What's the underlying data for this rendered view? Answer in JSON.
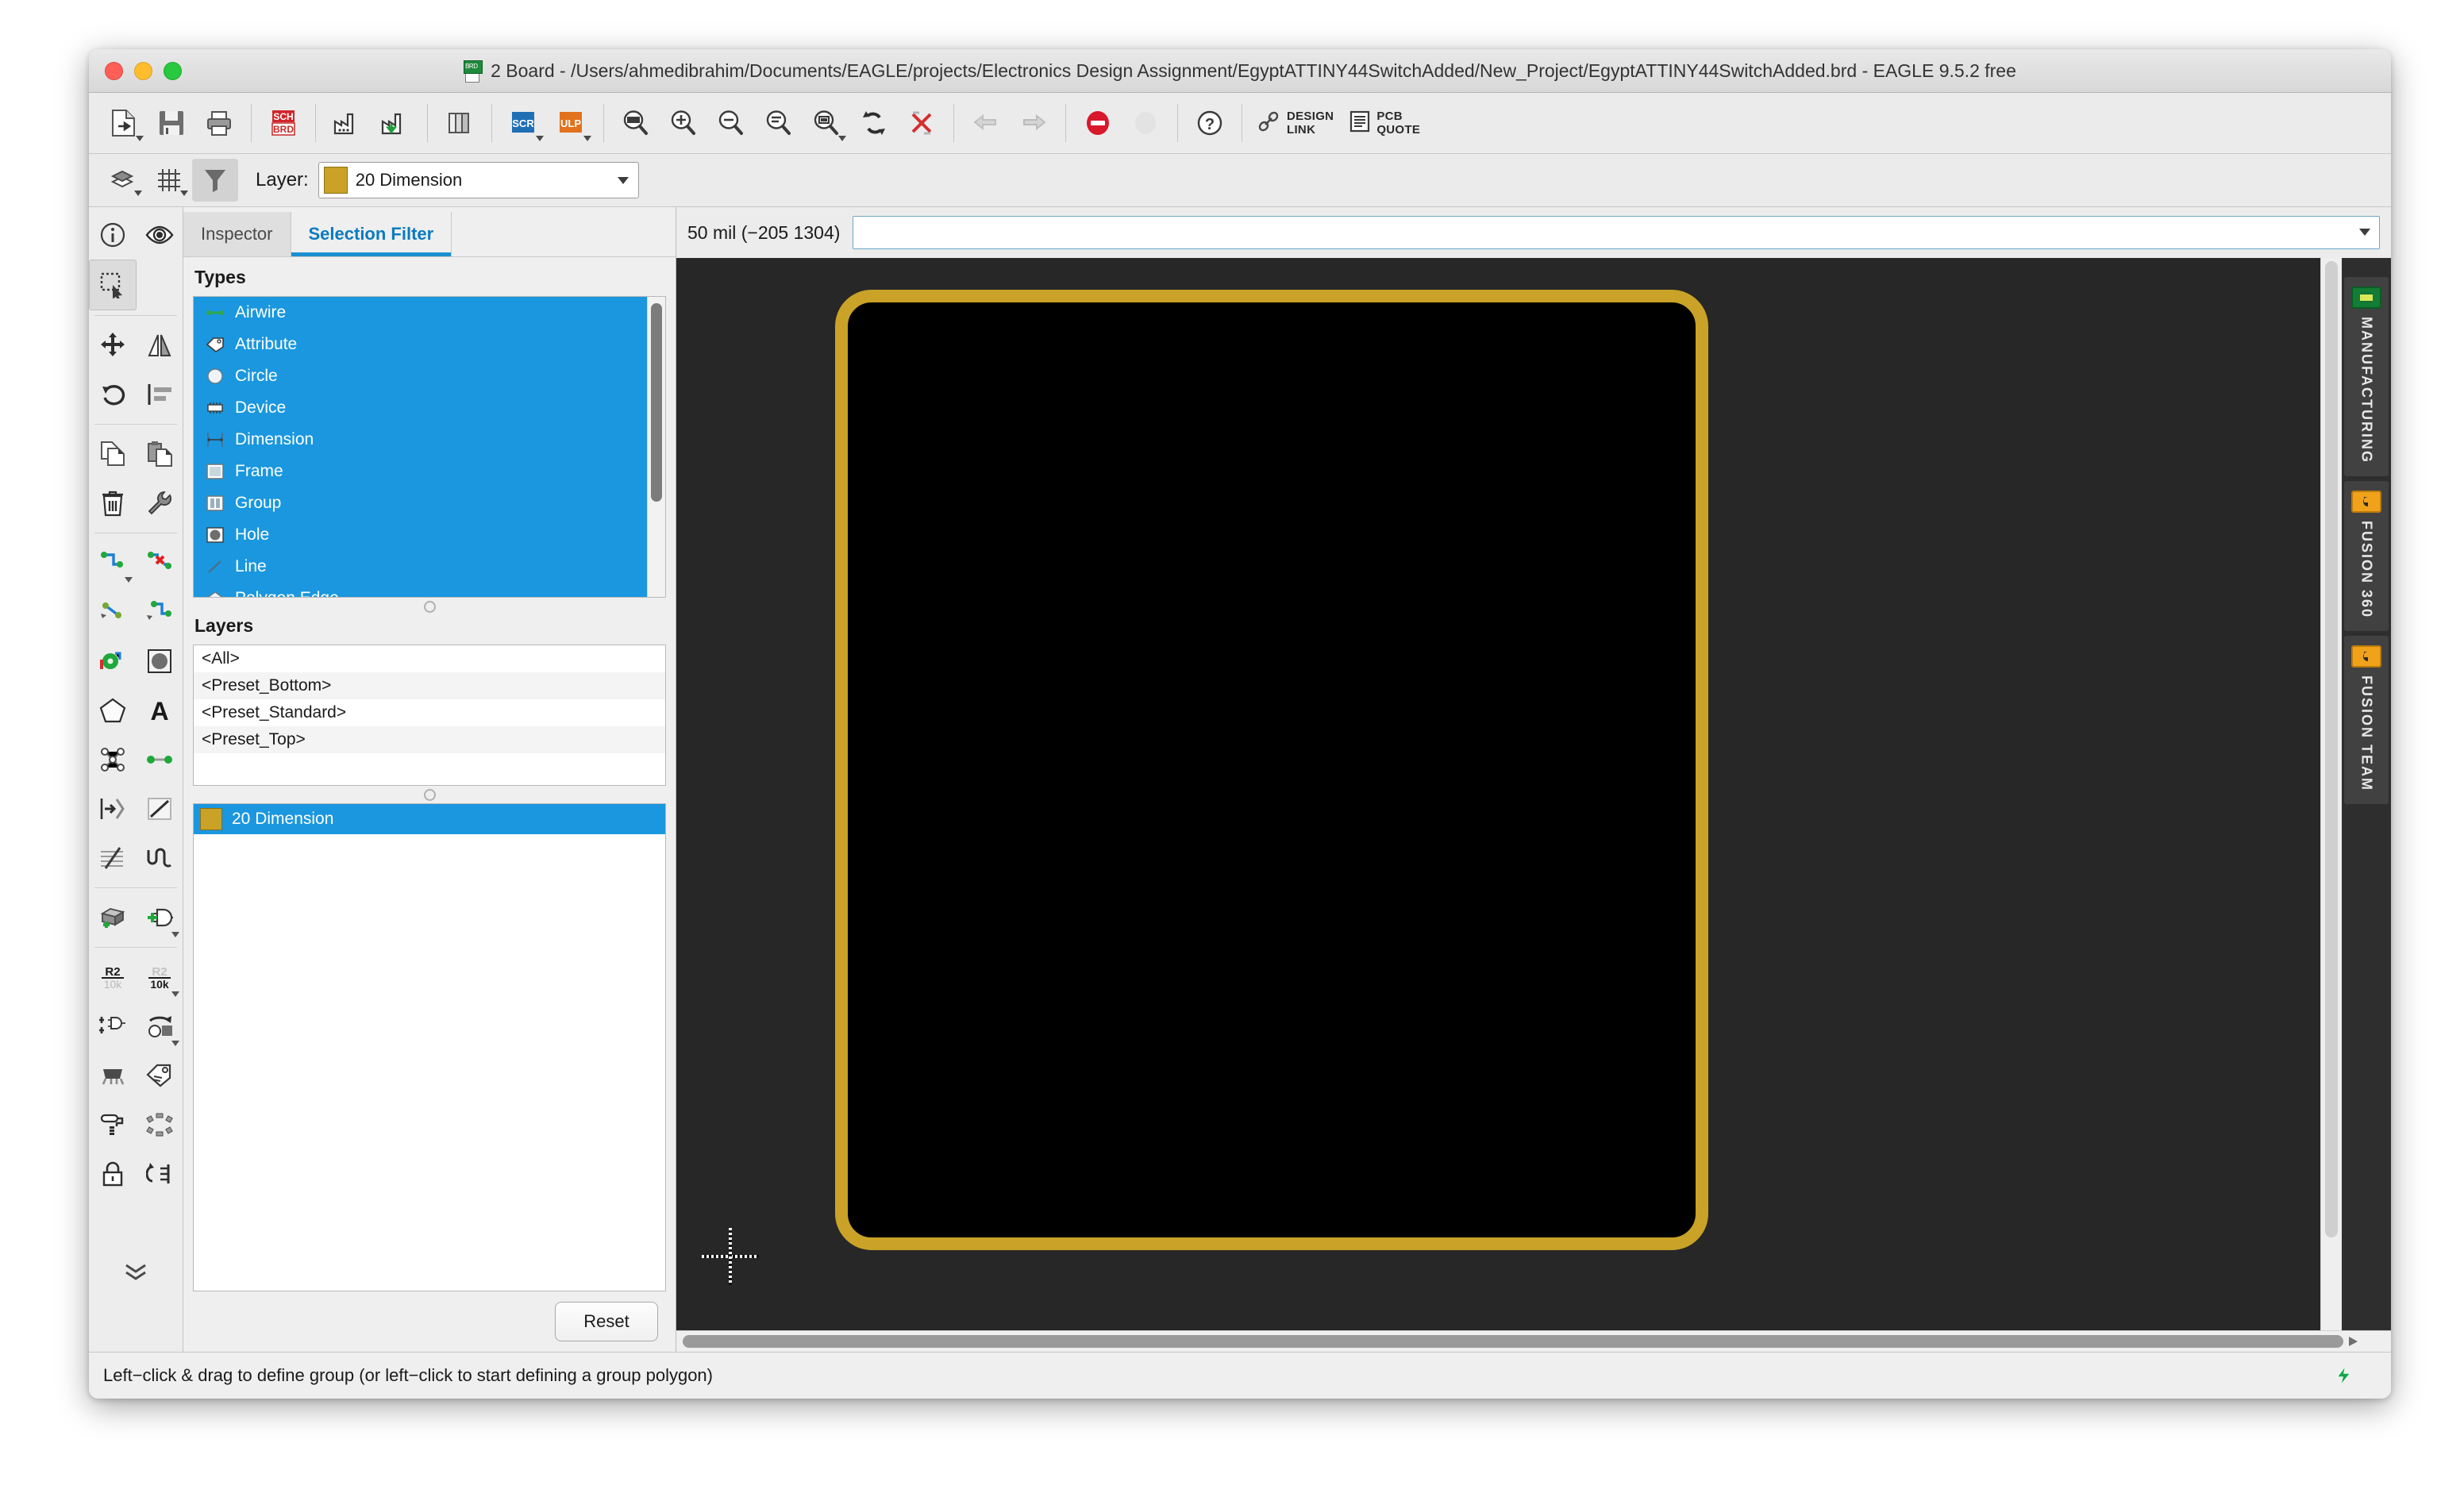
{
  "window": {
    "title": "2 Board - /Users/ahmedibrahim/Documents/EAGLE/projects/Electronics Design Assignment/EgyptATTINY44SwitchAdded/New_Project/EgyptATTINY44SwitchAdded.brd - EAGLE 9.5.2 free",
    "app_icon": "brd-file-icon",
    "controls": {
      "close": "close-button",
      "minimize": "minimize-button",
      "zoom": "zoom-button"
    }
  },
  "toolbar_main": {
    "items": [
      {
        "name": "new-file-button",
        "icon": "new-file-icon",
        "has_menu": true
      },
      {
        "name": "save-button",
        "icon": "floppy-disk-icon",
        "has_menu": false
      },
      {
        "name": "print-button",
        "icon": "printer-icon",
        "has_menu": false
      },
      {
        "name": "switch-to-schematic-button",
        "icon": "sch-brd-icon",
        "has_menu": false
      },
      {
        "name": "cam-processor-button",
        "icon": "factory-icon",
        "has_menu": false
      },
      {
        "name": "manufacturing-export-button",
        "icon": "factory-download-icon",
        "has_menu": false
      },
      {
        "name": "library-manager-button",
        "icon": "library-books-icon",
        "has_menu": false
      },
      {
        "name": "script-button",
        "icon": "scr-icon",
        "has_menu": true
      },
      {
        "name": "ulp-button",
        "icon": "ulp-icon",
        "has_menu": true
      },
      {
        "name": "zoom-fit-button",
        "icon": "zoom-fit-icon",
        "has_menu": false
      },
      {
        "name": "zoom-in-button",
        "icon": "zoom-in-icon",
        "has_menu": false
      },
      {
        "name": "zoom-out-button",
        "icon": "zoom-out-icon",
        "has_menu": false
      },
      {
        "name": "zoom-select-button",
        "icon": "zoom-select-icon",
        "has_menu": false
      },
      {
        "name": "zoom-region-button",
        "icon": "zoom-region-icon",
        "has_menu": true
      },
      {
        "name": "redraw-button",
        "icon": "refresh-icon",
        "has_menu": false
      },
      {
        "name": "ratsnest-button",
        "icon": "ratsnest-icon",
        "has_menu": false
      },
      {
        "name": "undo-button",
        "icon": "undo-arrow-icon",
        "has_menu": false
      },
      {
        "name": "redo-button",
        "icon": "redo-arrow-icon",
        "has_menu": false
      },
      {
        "name": "stop-button",
        "icon": "stop-sign-icon",
        "has_menu": false
      },
      {
        "name": "drc-button",
        "icon": "drc-icon",
        "has_menu": false
      },
      {
        "name": "help-button",
        "icon": "question-mark-icon",
        "has_menu": false
      }
    ],
    "design_link": {
      "line1": "DESIGN",
      "line2": "LINK",
      "icon": "chain-link-icon"
    },
    "pcb_quote": {
      "line1": "PCB",
      "line2": "QUOTE",
      "icon": "document-lines-icon"
    }
  },
  "toolbar_layers": {
    "display_layers_button": "layers-stack-icon",
    "grid_button": "grid-icon",
    "selection_filter_button": "funnel-icon",
    "layer_label": "Layer:",
    "layer_value": "20 Dimension",
    "layer_color": "#c9a227"
  },
  "tool_palette": {
    "groups": [
      {
        "tools": [
          {
            "name": "info-tool",
            "icon": "info-circle-icon",
            "selected": false
          },
          {
            "name": "show-tool",
            "icon": "eye-icon",
            "selected": false
          }
        ]
      },
      {
        "tools": [
          {
            "name": "group-tool",
            "icon": "marquee-select-icon",
            "selected": true
          }
        ]
      },
      {
        "tools": [
          {
            "name": "move-tool",
            "icon": "four-arrows-move-icon",
            "selected": false
          },
          {
            "name": "mirror-tool",
            "icon": "mirror-triangles-icon",
            "selected": false
          },
          {
            "name": "rotate-tool",
            "icon": "rotate-arrow-icon",
            "selected": false
          },
          {
            "name": "align-tool",
            "icon": "align-left-icon",
            "selected": false
          }
        ]
      },
      {
        "tools": [
          {
            "name": "copy-tool",
            "icon": "copy-pages-icon",
            "selected": false
          },
          {
            "name": "paste-tool",
            "icon": "clipboard-paste-icon",
            "selected": false
          },
          {
            "name": "delete-tool",
            "icon": "trash-can-icon",
            "selected": false
          },
          {
            "name": "change-tool",
            "icon": "wrench-icon",
            "selected": false
          }
        ]
      },
      {
        "tools": [
          {
            "name": "route-tool",
            "icon": "route-track-icon",
            "selected": false,
            "has_menu": true
          },
          {
            "name": "ripup-tool",
            "icon": "ripup-track-icon",
            "selected": false
          },
          {
            "name": "split-tool",
            "icon": "split-track-icon",
            "selected": false
          },
          {
            "name": "miter-tool",
            "icon": "miter-track-icon",
            "selected": false
          },
          {
            "name": "via-tool",
            "icon": "via-pad-icon",
            "selected": false
          },
          {
            "name": "hole-tool",
            "icon": "hole-pad-icon",
            "selected": false
          },
          {
            "name": "polygon-tool",
            "icon": "pentagon-polygon-icon",
            "selected": false
          },
          {
            "name": "text-tool",
            "icon": "letter-a-text-icon",
            "selected": false
          },
          {
            "name": "ratsnest-tool",
            "icon": "nodes-network-icon",
            "selected": false
          },
          {
            "name": "airwire-tool",
            "icon": "airwire-segment-icon",
            "selected": false
          },
          {
            "name": "signal-tool",
            "icon": "signal-arrow-icon",
            "selected": false
          },
          {
            "name": "wire-tool",
            "icon": "wire-corner-icon",
            "selected": false
          },
          {
            "name": "dimension-tool",
            "icon": "dimension-lines-icon",
            "selected": false
          },
          {
            "name": "meander-tool",
            "icon": "meander-wave-icon",
            "selected": false
          }
        ]
      },
      {
        "tools": [
          {
            "name": "add-package-tool",
            "icon": "add-part-box-icon",
            "selected": false
          },
          {
            "name": "add-part-tool",
            "icon": "add-gate-icon",
            "selected": false,
            "has_menu": true
          }
        ]
      },
      {
        "tools": [
          {
            "name": "name-tool",
            "icon": "r2-name-icon",
            "selected": false
          },
          {
            "name": "value-tool",
            "icon": "10k-value-icon",
            "selected": false,
            "has_menu": true
          },
          {
            "name": "smash-tool",
            "icon": "smash-gates-icon",
            "selected": false
          },
          {
            "name": "replace-tool",
            "icon": "replace-package-icon",
            "selected": false,
            "has_menu": true
          },
          {
            "name": "package-tool",
            "icon": "ic-chip-icon",
            "selected": false
          },
          {
            "name": "attribute-tool",
            "icon": "attribute-tag-icon",
            "selected": false
          },
          {
            "name": "paint-tool",
            "icon": "paint-roller-icon",
            "selected": false
          },
          {
            "name": "array-tool",
            "icon": "array-pattern-icon",
            "selected": false
          },
          {
            "name": "lock-tool",
            "icon": "padlock-icon",
            "selected": false
          },
          {
            "name": "swap-tool",
            "icon": "swap-pins-icon",
            "selected": false
          }
        ]
      }
    ],
    "expand_button": {
      "name": "expand-palette-button",
      "icon": "double-chevron-down-icon"
    }
  },
  "filter_panel": {
    "tabs": [
      {
        "label": "Inspector",
        "active": false
      },
      {
        "label": "Selection Filter",
        "active": true
      }
    ],
    "types_heading": "Types",
    "types": [
      {
        "label": "Airwire",
        "icon": "airwire-icon",
        "selected": true
      },
      {
        "label": "Attribute",
        "icon": "attribute-tag-icon",
        "selected": true
      },
      {
        "label": "Circle",
        "icon": "circle-icon",
        "selected": true
      },
      {
        "label": "Device",
        "icon": "device-chip-icon",
        "selected": true
      },
      {
        "label": "Dimension",
        "icon": "dimension-icon",
        "selected": true
      },
      {
        "label": "Frame",
        "icon": "frame-icon",
        "selected": true
      },
      {
        "label": "Group",
        "icon": "group-icon",
        "selected": true
      },
      {
        "label": "Hole",
        "icon": "hole-icon",
        "selected": true
      },
      {
        "label": "Line",
        "icon": "line-icon",
        "selected": true
      },
      {
        "label": "Polygon Edge",
        "icon": "polygon-edge-icon",
        "selected": true
      }
    ],
    "layers_heading": "Layers",
    "layer_presets": [
      "<All>",
      "<Preset_Bottom>",
      "<Preset_Standard>",
      "<Preset_Top>"
    ],
    "selected_layers": [
      {
        "label": "20 Dimension",
        "color": "#c9a227",
        "selected": true
      }
    ],
    "reset_label": "Reset"
  },
  "command_bar": {
    "coordinate_text": "50 mil (−205 1304)",
    "command_value": "",
    "command_placeholder": ""
  },
  "canvas": {
    "background_color": "#272727",
    "board_outline_color": "#c9a227",
    "board_fill_color": "#000000",
    "origin_marker": "origin-crosshair"
  },
  "right_rail": {
    "tabs": [
      {
        "label": "MANUFACTURING",
        "icon": "pcb-board-icon"
      },
      {
        "label": "FUSION 360",
        "icon": "fusion-logo-icon"
      },
      {
        "label": "FUSION TEAM",
        "icon": "fusion-logo-icon"
      }
    ]
  },
  "status_bar": {
    "message": "Left−click & drag to define group (or left−click to start defining a group polygon)",
    "indicator_icon": "green-bolt-icon"
  }
}
